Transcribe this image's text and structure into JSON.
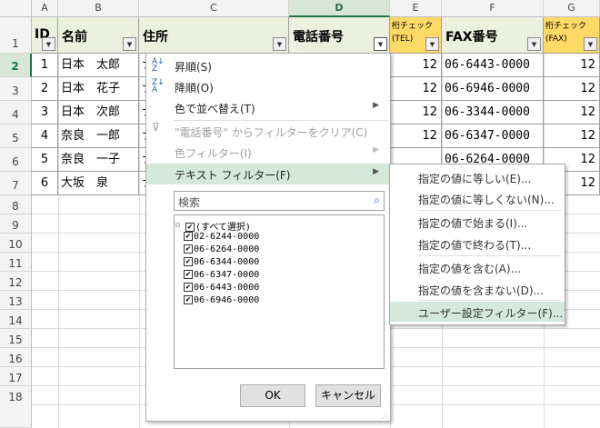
{
  "columns": [
    "A",
    "B",
    "C",
    "D",
    "E",
    "F",
    "G"
  ],
  "rows": [
    "1",
    "2",
    "3",
    "4",
    "5",
    "6",
    "7",
    "8",
    "9",
    "10",
    "11",
    "12",
    "13",
    "14",
    "15",
    "16",
    "17",
    "18"
  ],
  "headers": {
    "a": "ID",
    "b": "名前",
    "c": "住所",
    "d": "電話番号",
    "e_line1": "桁チェック",
    "e_line2": "(TEL)",
    "f": "FAX番号",
    "g_line1": "桁チェック",
    "g_line2": "(FAX)"
  },
  "data_rows": [
    {
      "id": "1",
      "name": "日本　太郎",
      "tel_check": "12",
      "fax": "06-6443-0000",
      "fax_check": "12"
    },
    {
      "id": "2",
      "name": "日本　花子",
      "tel_check": "12",
      "fax": "06-6946-0000",
      "fax_check": "12"
    },
    {
      "id": "3",
      "name": "日本　次郎",
      "tel_check": "12",
      "fax": "06-3344-0000",
      "fax_check": "12"
    },
    {
      "id": "4",
      "name": "奈良　一郎",
      "tel_check": "12",
      "fax": "06-6347-0000",
      "fax_check": "12"
    },
    {
      "id": "5",
      "name": "奈良　一子",
      "tel_check": "",
      "fax": "06-6264-0000",
      "fax_check": "12"
    },
    {
      "id": "6",
      "name": "大坂　泉",
      "tel_check": "",
      "fax": "",
      "fax_check": "12"
    }
  ],
  "address_fragment": "ナ",
  "filter_menu": {
    "sort_asc": "昇順(S)",
    "sort_desc": "降順(O)",
    "sort_by_color": "色で並べ替え(T)",
    "clear_filter": "\"電話番号\" からフィルターをクリア(C)",
    "color_filter": "色フィルター(I)",
    "text_filter": "テキスト フィルター(F)",
    "search_placeholder": "検索",
    "items": [
      "(すべて選択)",
      "02-6244-0000",
      "06-6264-0000",
      "06-6344-0000",
      "06-6347-0000",
      "06-6443-0000",
      "06-6946-0000"
    ],
    "ok": "OK",
    "cancel": "キャンセル"
  },
  "text_filter_submenu": [
    "指定の値に等しい(E)...",
    "指定の値に等しくない(N)...",
    "指定の値で始まる(I)...",
    "指定の値で終わる(T)...",
    "指定の値を含む(A)...",
    "指定の値を含まない(D)...",
    "ユーザー設定フィルター(F)..."
  ],
  "colors": {
    "header_green": "#ebf1de",
    "header_yellow": "#ffd966",
    "accent_green": "#217346",
    "highlight": "#d4e8dc"
  }
}
